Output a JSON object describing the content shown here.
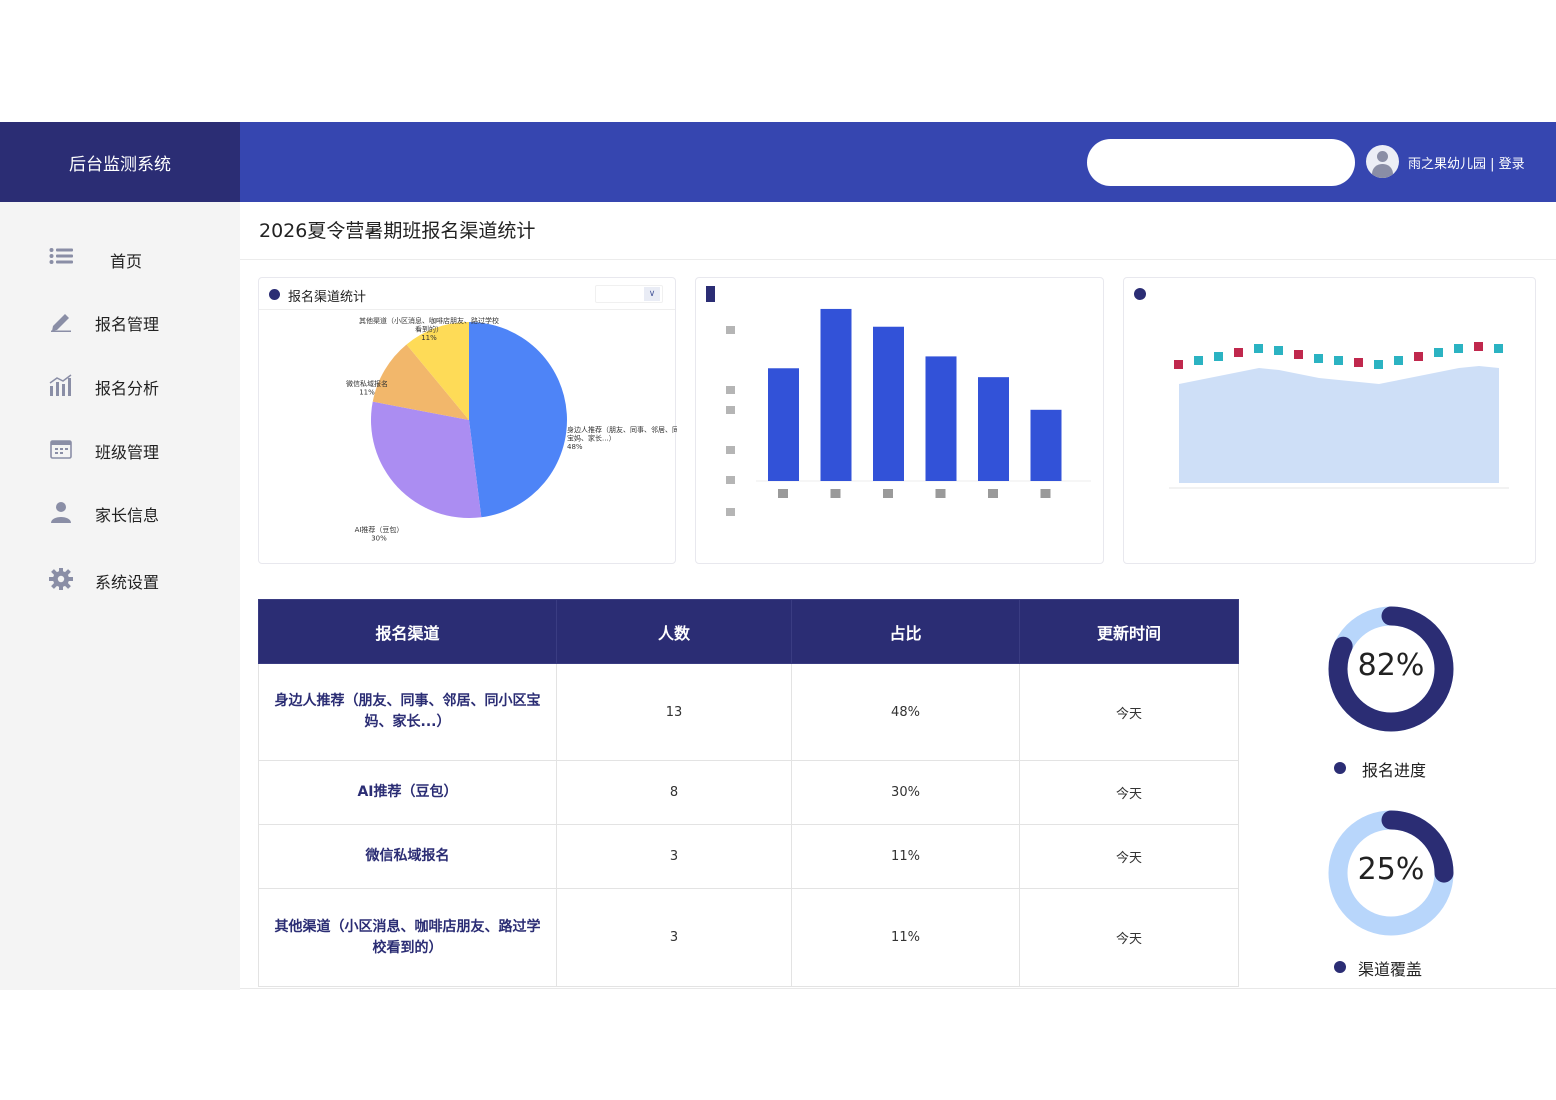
{
  "header": {
    "brand": "后台监测系统",
    "search_placeholder": "",
    "user_label": "雨之果幼儿园 | ",
    "login_label": "登录"
  },
  "sidebar": {
    "items": [
      {
        "label": "首页",
        "icon": "list-icon"
      },
      {
        "label": "报名管理",
        "icon": "pencil-icon"
      },
      {
        "label": "报名分析",
        "icon": "bar-chart-icon"
      },
      {
        "label": "班级管理",
        "icon": "calendar-icon"
      },
      {
        "label": "家长信息",
        "icon": "person-icon"
      },
      {
        "label": "系统设置",
        "icon": "gear-icon"
      }
    ]
  },
  "page": {
    "title": "2026夏令营暑期班报名渠道统计"
  },
  "pie_card": {
    "title": "报名渠道统计"
  },
  "colors": {
    "primary_dark": "#2b2d74",
    "header_blue": "#3646b0",
    "bar_blue": "#3252d8",
    "donut_light": "#b8d6fb"
  },
  "chart_data": [
    {
      "type": "pie",
      "title": "报名渠道统计",
      "slices": [
        {
          "label": "身边人推荐（朋友、同事、邻居、同小区宝妈、家长...）",
          "value": 48,
          "pct_label": "48%",
          "color": "#4e84f7"
        },
        {
          "label": "AI推荐（豆包）",
          "value": 30,
          "pct_label": "30%",
          "color": "#ab8df2"
        },
        {
          "label": "微信私域报名",
          "value": 11,
          "pct_label": "11%",
          "color": "#f2b76b"
        },
        {
          "label": "其他渠道（小区消息、咖啡店朋友、路过学校看到的）",
          "value": 11,
          "pct_label": "11%",
          "color": "#fedb57"
        }
      ]
    },
    {
      "type": "bar",
      "values": [
        38,
        58,
        52,
        42,
        35,
        24
      ],
      "ylim": [
        0,
        60
      ]
    },
    {
      "type": "area",
      "series": [
        {
          "values": [
            22,
            24,
            26,
            28,
            30,
            29,
            27,
            25,
            24,
            23,
            22,
            24,
            26,
            28,
            30,
            31,
            30
          ]
        }
      ]
    }
  ],
  "table": {
    "headers": [
      "报名渠道",
      "人数",
      "占比",
      "更新时间"
    ],
    "rows": [
      {
        "channel": "身边人推荐（朋友、同事、邻居、同小区宝妈、家长...）",
        "count": "13",
        "ratio": "48%",
        "time": "今天"
      },
      {
        "channel": "AI推荐（豆包）",
        "count": "8",
        "ratio": "30%",
        "time": "今天"
      },
      {
        "channel": "微信私域报名",
        "count": "3",
        "ratio": "11%",
        "time": "今天"
      },
      {
        "channel": "其他渠道（小区消息、咖啡店朋友、路过学校看到的）",
        "count": "3",
        "ratio": "11%",
        "time": "今天"
      }
    ]
  },
  "donuts": [
    {
      "value_label": "82%",
      "fraction": 0.82,
      "label": "报名进度"
    },
    {
      "value_label": "25%",
      "fraction": 0.25,
      "label": "渠道覆盖"
    }
  ]
}
